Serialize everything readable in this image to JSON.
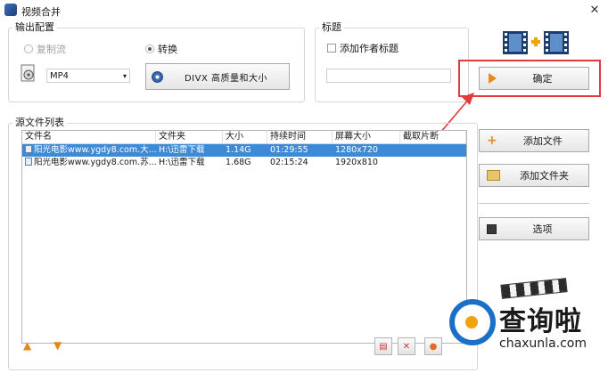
{
  "window": {
    "title": "视频合并",
    "close_glyph": "✕"
  },
  "output_config": {
    "group_label": "输出配置",
    "radio_copy": "复制流",
    "radio_convert": "转换",
    "format_select_value": "MP4",
    "quality_button": "DIVX 高质量和大小"
  },
  "title_section": {
    "group_label": "标题",
    "add_author_title_label": "添加作者标题",
    "title_input_value": ""
  },
  "actions": {
    "confirm": "确定",
    "add_file": "添加文件",
    "add_folder": "添加文件夹",
    "options": "选项"
  },
  "file_list": {
    "group_label": "源文件列表",
    "columns": [
      "文件名",
      "文件夹",
      "大小",
      "持续时间",
      "屏幕大小",
      "截取片断"
    ],
    "rows": [
      {
        "name": "阳光电影www.ygdy8.com.大...",
        "folder": "H:\\迅雷下载",
        "size": "1.14G",
        "duration": "01:29:55",
        "resolution": "1280x720",
        "clip": "",
        "selected": true
      },
      {
        "name": "阳光电影www.ygdy8.com.苏...",
        "folder": "H:\\迅雷下载",
        "size": "1.68G",
        "duration": "02:15:24",
        "resolution": "1920x810",
        "clip": "",
        "selected": false
      }
    ]
  },
  "watermark": {
    "brand": "查询啦",
    "domain": "chaxunla.com"
  },
  "colors": {
    "highlight_red": "#e23b3b",
    "selection_blue": "#3d8ad6",
    "watermark_blue": "#1a6fc9"
  }
}
